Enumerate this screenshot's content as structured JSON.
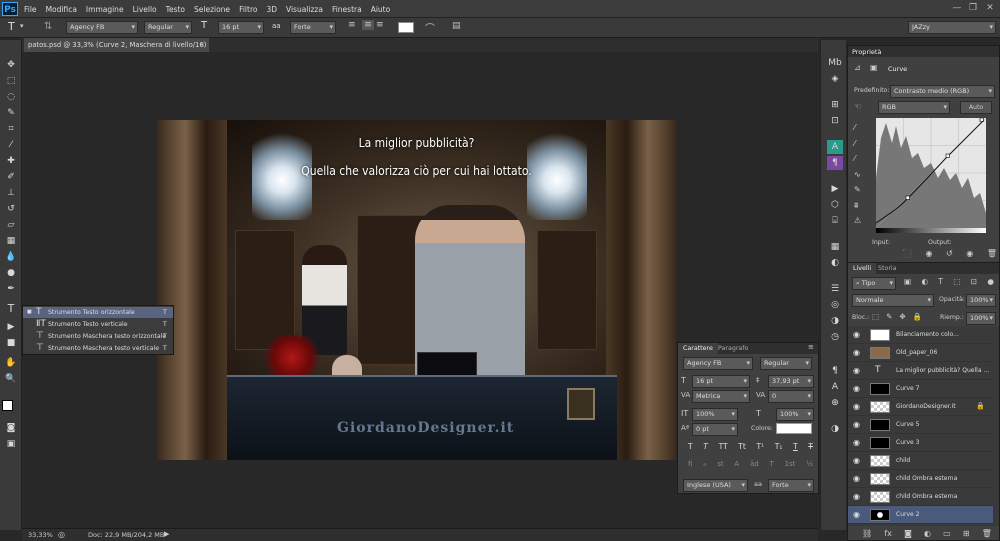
{
  "app": {
    "logo": "Ps"
  },
  "menubar": {
    "items": [
      "File",
      "Modifica",
      "Immagine",
      "Livello",
      "Testo",
      "Selezione",
      "Filtro",
      "3D",
      "Visualizza",
      "Finestra",
      "Aiuto"
    ],
    "workspace": "JAZzy"
  },
  "options": {
    "font_family": "Agency FB",
    "font_style": "Regular",
    "font_size": "16 pt",
    "antialias_icon": "aa",
    "antialias": "Forte"
  },
  "document": {
    "tab_title": "patos.psd @ 33,3% (Curve 2, Maschera di livello/16)"
  },
  "canvas": {
    "headline_1": "La miglior pubblicità?",
    "headline_2": "Quella che valorizza ciò per cui hai lottato.",
    "watermark": "GiordanoDesigner.it"
  },
  "flyout": {
    "items": [
      "Strumento Testo orizzontale",
      "Strumento Testo verticale",
      "Strumento Maschera testo orizzontale",
      "Strumento Maschera testo verticale"
    ],
    "shortcut": "T"
  },
  "character": {
    "tabs": [
      "Carattere",
      "Paragrafo"
    ],
    "font_family": "Agency FB",
    "font_style": "Regular",
    "size": "16 pt",
    "leading": "37,93 pt",
    "kerning": "Metrica",
    "tracking": "0",
    "vscale": "100%",
    "hscale": "100%",
    "baseline": "0 pt",
    "color_label": "Colore:",
    "language": "Inglese (USA)",
    "antialias": "Forte",
    "style_buttons": [
      "T",
      "T",
      "TT",
      "Tt",
      "T¹",
      "T₁",
      "T",
      "T"
    ],
    "ot_buttons": [
      "fi",
      "ℴ",
      "st",
      "A",
      "ād",
      "T",
      "1st",
      "½"
    ]
  },
  "properties": {
    "title": "Proprietà",
    "kind": "Curve",
    "preset_label": "Predefinito:",
    "preset": "Contrasto medio (RGB)",
    "channel": "RGB",
    "auto_label": "Auto",
    "input_label": "Input:",
    "output_label": "Output:"
  },
  "layers": {
    "tabs": [
      "Livelli",
      "Storia"
    ],
    "filter_kind": "Tipo",
    "blend_mode": "Normale",
    "opacity_label": "Opacità:",
    "opacity": "100%",
    "lock_label": "Bloc.:",
    "fill_label": "Riemp.:",
    "fill": "100%",
    "items": [
      {
        "name": "Bilanciamento colo...",
        "thumb": "white",
        "eye": "👁"
      },
      {
        "name": "Old_paper_06",
        "thumb": "paper",
        "eye": "👁"
      },
      {
        "name": "La miglior pubblicità? Quella ...",
        "thumb": "text",
        "eye": "👁"
      },
      {
        "name": "Curve 7",
        "thumb": "black",
        "eye": "👁"
      },
      {
        "name": "GiordanoDesigner.it",
        "thumb": "check",
        "eye": "👁"
      },
      {
        "name": "Curve 5",
        "thumb": "black",
        "eye": "👁"
      },
      {
        "name": "Curve 3",
        "thumb": "black",
        "eye": "👁"
      },
      {
        "name": "child",
        "thumb": "check",
        "eye": "👁"
      },
      {
        "name": "child Ombra esterna",
        "thumb": "check",
        "eye": "👁"
      },
      {
        "name": "child Ombra esterna",
        "thumb": "check",
        "eye": "👁"
      },
      {
        "name": "Curve 2",
        "thumb": "mask",
        "eye": "👁"
      }
    ]
  },
  "status": {
    "zoom": "33,33%",
    "doc": "Doc: 22,9 MB/204,2 MB"
  }
}
